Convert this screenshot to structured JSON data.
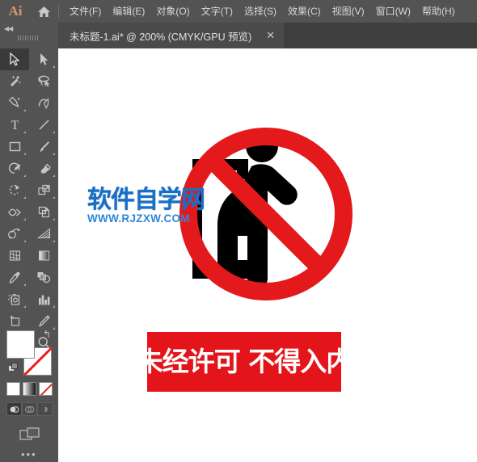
{
  "app": {
    "name": "Ai",
    "logo_color": "#d9936a",
    "home_icon": "home-icon"
  },
  "menubar": {
    "items": [
      {
        "label": "文件(F)",
        "name": "menu-file"
      },
      {
        "label": "编辑(E)",
        "name": "menu-edit"
      },
      {
        "label": "对象(O)",
        "name": "menu-object"
      },
      {
        "label": "文字(T)",
        "name": "menu-type"
      },
      {
        "label": "选择(S)",
        "name": "menu-select"
      },
      {
        "label": "效果(C)",
        "name": "menu-effect"
      },
      {
        "label": "视图(V)",
        "name": "menu-view"
      },
      {
        "label": "窗口(W)",
        "name": "menu-window"
      },
      {
        "label": "帮助(H)",
        "name": "menu-help"
      }
    ]
  },
  "tabbar": {
    "collapse_glyph": "◀◀",
    "document": {
      "title": "未标题-1.ai* @ 200% (CMYK/GPU 预览)",
      "filename": "未标题-1.ai",
      "modified": true,
      "zoom": "200%",
      "color_mode": "CMYK",
      "preview_mode": "GPU 预览",
      "close_glyph": "✕"
    }
  },
  "toolbar": {
    "active_tool": "selection-tool",
    "tools": [
      {
        "name": "selection-tool",
        "label": "选择工具",
        "active": true,
        "corner": false
      },
      {
        "name": "direct-selection-tool",
        "label": "直接选择工具",
        "active": false,
        "corner": true
      },
      {
        "name": "magic-wand-tool",
        "label": "魔棒工具",
        "active": false,
        "corner": false
      },
      {
        "name": "lasso-tool",
        "label": "套索工具",
        "active": false,
        "corner": false
      },
      {
        "name": "pen-tool",
        "label": "钢笔工具",
        "active": false,
        "corner": true
      },
      {
        "name": "curvature-tool",
        "label": "曲率工具",
        "active": false,
        "corner": false
      },
      {
        "name": "type-tool",
        "label": "文字工具",
        "active": false,
        "corner": true
      },
      {
        "name": "line-segment-tool",
        "label": "直线段工具",
        "active": false,
        "corner": true
      },
      {
        "name": "rectangle-tool",
        "label": "矩形工具",
        "active": false,
        "corner": true
      },
      {
        "name": "paintbrush-tool",
        "label": "画笔工具",
        "active": false,
        "corner": true
      },
      {
        "name": "shaper-tool",
        "label": "Shaper 工具",
        "active": false,
        "corner": true
      },
      {
        "name": "eraser-tool",
        "label": "橡皮擦工具",
        "active": false,
        "corner": true
      },
      {
        "name": "rotate-tool",
        "label": "旋转工具",
        "active": false,
        "corner": true
      },
      {
        "name": "scale-tool",
        "label": "比例缩放工具",
        "active": false,
        "corner": true
      },
      {
        "name": "width-tool",
        "label": "宽度工具",
        "active": false,
        "corner": true
      },
      {
        "name": "free-transform-tool",
        "label": "自由变换工具",
        "active": false,
        "corner": true
      },
      {
        "name": "shape-builder-tool",
        "label": "形状生成器工具",
        "active": false,
        "corner": true
      },
      {
        "name": "perspective-grid-tool",
        "label": "透视网格工具",
        "active": false,
        "corner": true
      },
      {
        "name": "mesh-tool",
        "label": "网格工具",
        "active": false,
        "corner": false
      },
      {
        "name": "gradient-tool",
        "label": "渐变工具",
        "active": false,
        "corner": false
      },
      {
        "name": "eyedropper-tool",
        "label": "吸管工具",
        "active": false,
        "corner": true
      },
      {
        "name": "blend-tool",
        "label": "混合工具",
        "active": false,
        "corner": false
      },
      {
        "name": "symbol-sprayer-tool",
        "label": "符号喷枪工具",
        "active": false,
        "corner": true
      },
      {
        "name": "column-graph-tool",
        "label": "柱形图工具",
        "active": false,
        "corner": true
      },
      {
        "name": "artboard-tool",
        "label": "画板工具",
        "active": false,
        "corner": false
      },
      {
        "name": "slice-tool",
        "label": "切片工具",
        "active": false,
        "corner": true
      },
      {
        "name": "hand-tool",
        "label": "抓手工具",
        "active": false,
        "corner": true
      },
      {
        "name": "zoom-tool",
        "label": "缩放工具",
        "active": false,
        "corner": false
      }
    ],
    "color_controls": {
      "fill_color": "#ffffff",
      "stroke_color": "none",
      "swap_glyph": "↰",
      "modes": [
        {
          "name": "color-mode-solid",
          "label": "颜色"
        },
        {
          "name": "color-mode-gradient",
          "label": "渐变"
        },
        {
          "name": "color-mode-none",
          "label": "无"
        }
      ],
      "draw_modes": [
        {
          "name": "draw-normal-mode",
          "label": "正常绘图",
          "selected": true
        },
        {
          "name": "draw-behind-mode",
          "label": "背面绘图",
          "selected": false
        },
        {
          "name": "draw-inside-mode",
          "label": "内部绘图",
          "selected": false
        }
      ],
      "screen_mode": "screen-mode-button",
      "more_glyph": "•••"
    }
  },
  "canvas": {
    "background": "#ffffff",
    "zoom_level": "200%",
    "artwork": {
      "title": "禁止入内标志",
      "prohibition_sign": {
        "name": "no-entry-prohibition-sign",
        "ring_color": "#e3191c",
        "slash_color": "#e3191c",
        "pictogram_color": "#000000",
        "pictogram": "person-exiting-doorway"
      },
      "banner": {
        "name": "warning-banner",
        "text": "未经许可 不得入内",
        "background": "#e4151a",
        "text_color": "#ffffff"
      }
    },
    "watermark": {
      "name": "site-watermark",
      "chinese": "软件自学网",
      "url": "WWW.RJZXW.COM",
      "color": "#1a6fc4"
    }
  }
}
